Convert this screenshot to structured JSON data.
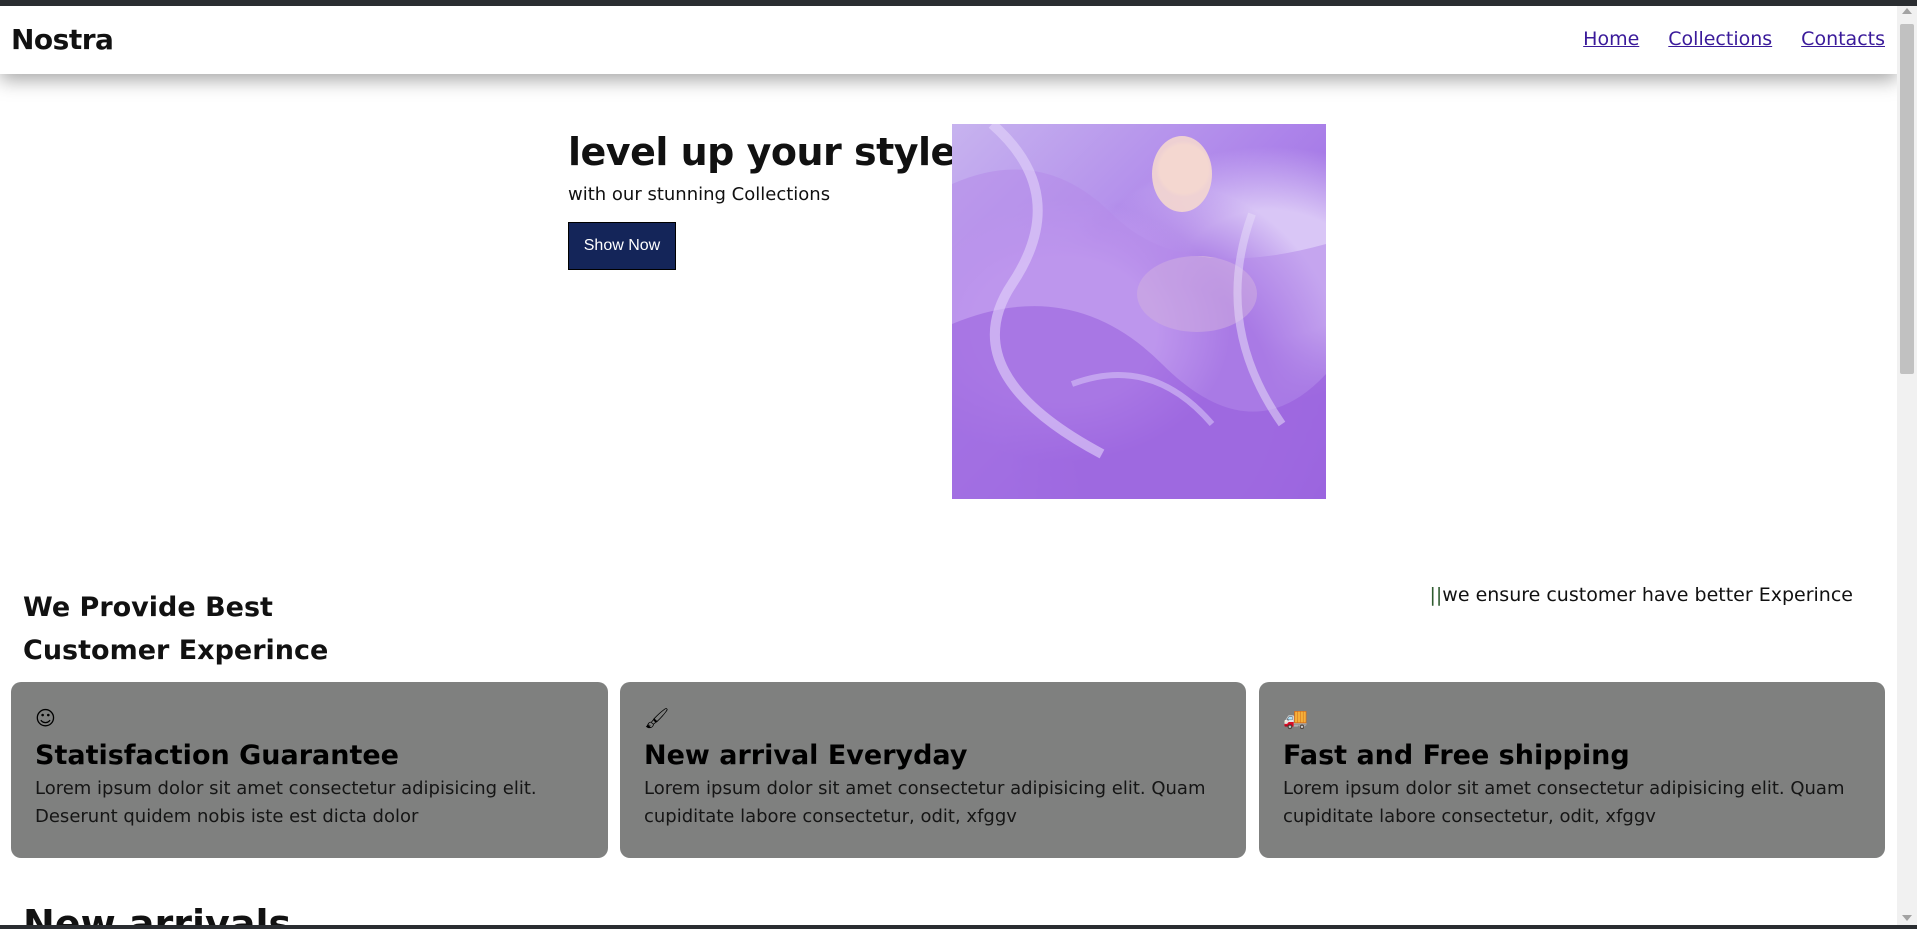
{
  "header": {
    "logo": "Nostra",
    "nav": [
      "Home",
      "Collections",
      "Contacts"
    ]
  },
  "hero": {
    "title": "level up your style",
    "subtitle": "with our stunning Collections",
    "button_label": "Show Now"
  },
  "features": {
    "heading_line1": "We Provide Best",
    "heading_line2": "Customer Experince",
    "tagline_bars": "||",
    "tagline": "we ensure customer have better Experince",
    "cards": [
      {
        "icon": "smiley-icon",
        "glyph": "☺",
        "title": "Statisfaction Guarantee",
        "text": "Lorem ipsum dolor sit amet consectetur adipisicing elit. Deserunt quidem nobis iste est dicta dolor"
      },
      {
        "icon": "paintbrush-icon",
        "glyph": "🖌",
        "title": "New arrival Everyday",
        "text": "Lorem ipsum dolor sit amet consectetur adipisicing elit. Quam cupiditate labore consectetur, odit, xfggv"
      },
      {
        "icon": "truck-icon",
        "glyph": "🚚",
        "title": "Fast and Free shipping",
        "text": "Lorem ipsum dolor sit amet consectetur adipisicing elit. Quam cupiditate labore consectetur, odit, xfggv"
      }
    ]
  },
  "new_arrivals": {
    "heading": "New arrivals"
  }
}
